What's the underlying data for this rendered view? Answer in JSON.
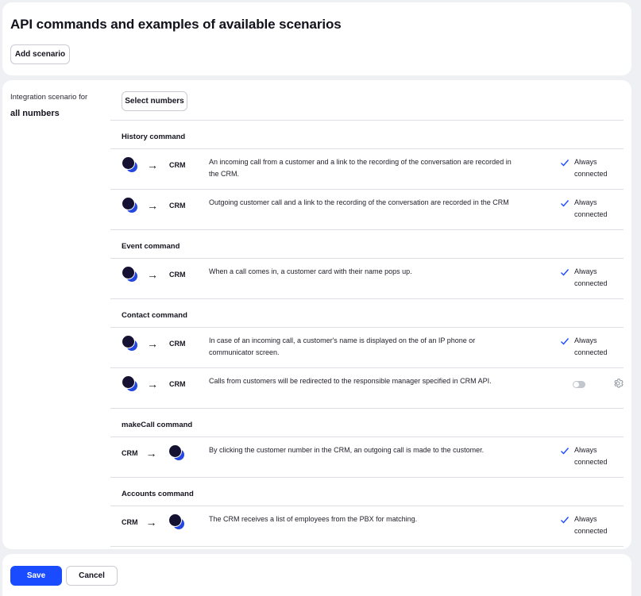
{
  "header": {
    "title": "API commands and examples of available scenarios",
    "add_scenario_label": "Add scenario"
  },
  "scenario": {
    "label": "Integration scenario for",
    "value": "all numbers",
    "select_numbers_label": "Select numbers"
  },
  "sections": [
    {
      "title": "History command",
      "rows": [
        {
          "from": "avatar",
          "to": "CRM",
          "description": "An incoming call from a customer and a link to the recording of the conversation are recorded in the CRM.",
          "status": "Always connected"
        },
        {
          "from": "avatar",
          "to": "CRM",
          "description": "Outgoing customer call and a link to the recording of the conversation are recorded in the CRM",
          "status": "Always connected"
        }
      ]
    },
    {
      "title": "Event command",
      "rows": [
        {
          "from": "avatar",
          "to": "CRM",
          "description": "When a call comes in, a customer card with their name pops up.",
          "status": "Always connected"
        }
      ]
    },
    {
      "title": "Contact command",
      "rows": [
        {
          "from": "avatar",
          "to": "CRM",
          "description": "In case of an incoming call, a customer's name is displayed on the of an IP phone or communicator screen.",
          "status": "Always connected"
        },
        {
          "from": "avatar",
          "to": "CRM",
          "description": "Calls from customers will be redirected to the responsible manager specified in CRM API.",
          "toggle": "off",
          "has_settings": true
        }
      ]
    },
    {
      "title": "makeCall command",
      "rows": [
        {
          "from": "CRM",
          "to": "avatar",
          "description": "By clicking the customer number in the CRM, an outgoing call is made to the customer.",
          "status": "Always connected"
        }
      ]
    },
    {
      "title": "Accounts command",
      "rows": [
        {
          "from": "CRM",
          "to": "avatar",
          "description": "The CRM receives a list of employees from the PBX for matching.",
          "status": "Always connected"
        }
      ]
    }
  ],
  "footer": {
    "save_label": "Save",
    "cancel_label": "Cancel"
  },
  "colors": {
    "accent": "#1a4bff",
    "avatar_dark": "#151133",
    "avatar_blue": "#2447e0",
    "check": "#1a4bff"
  },
  "icons": [
    "arrow-right-icon",
    "check-icon",
    "gear-icon",
    "avatar-icon"
  ]
}
